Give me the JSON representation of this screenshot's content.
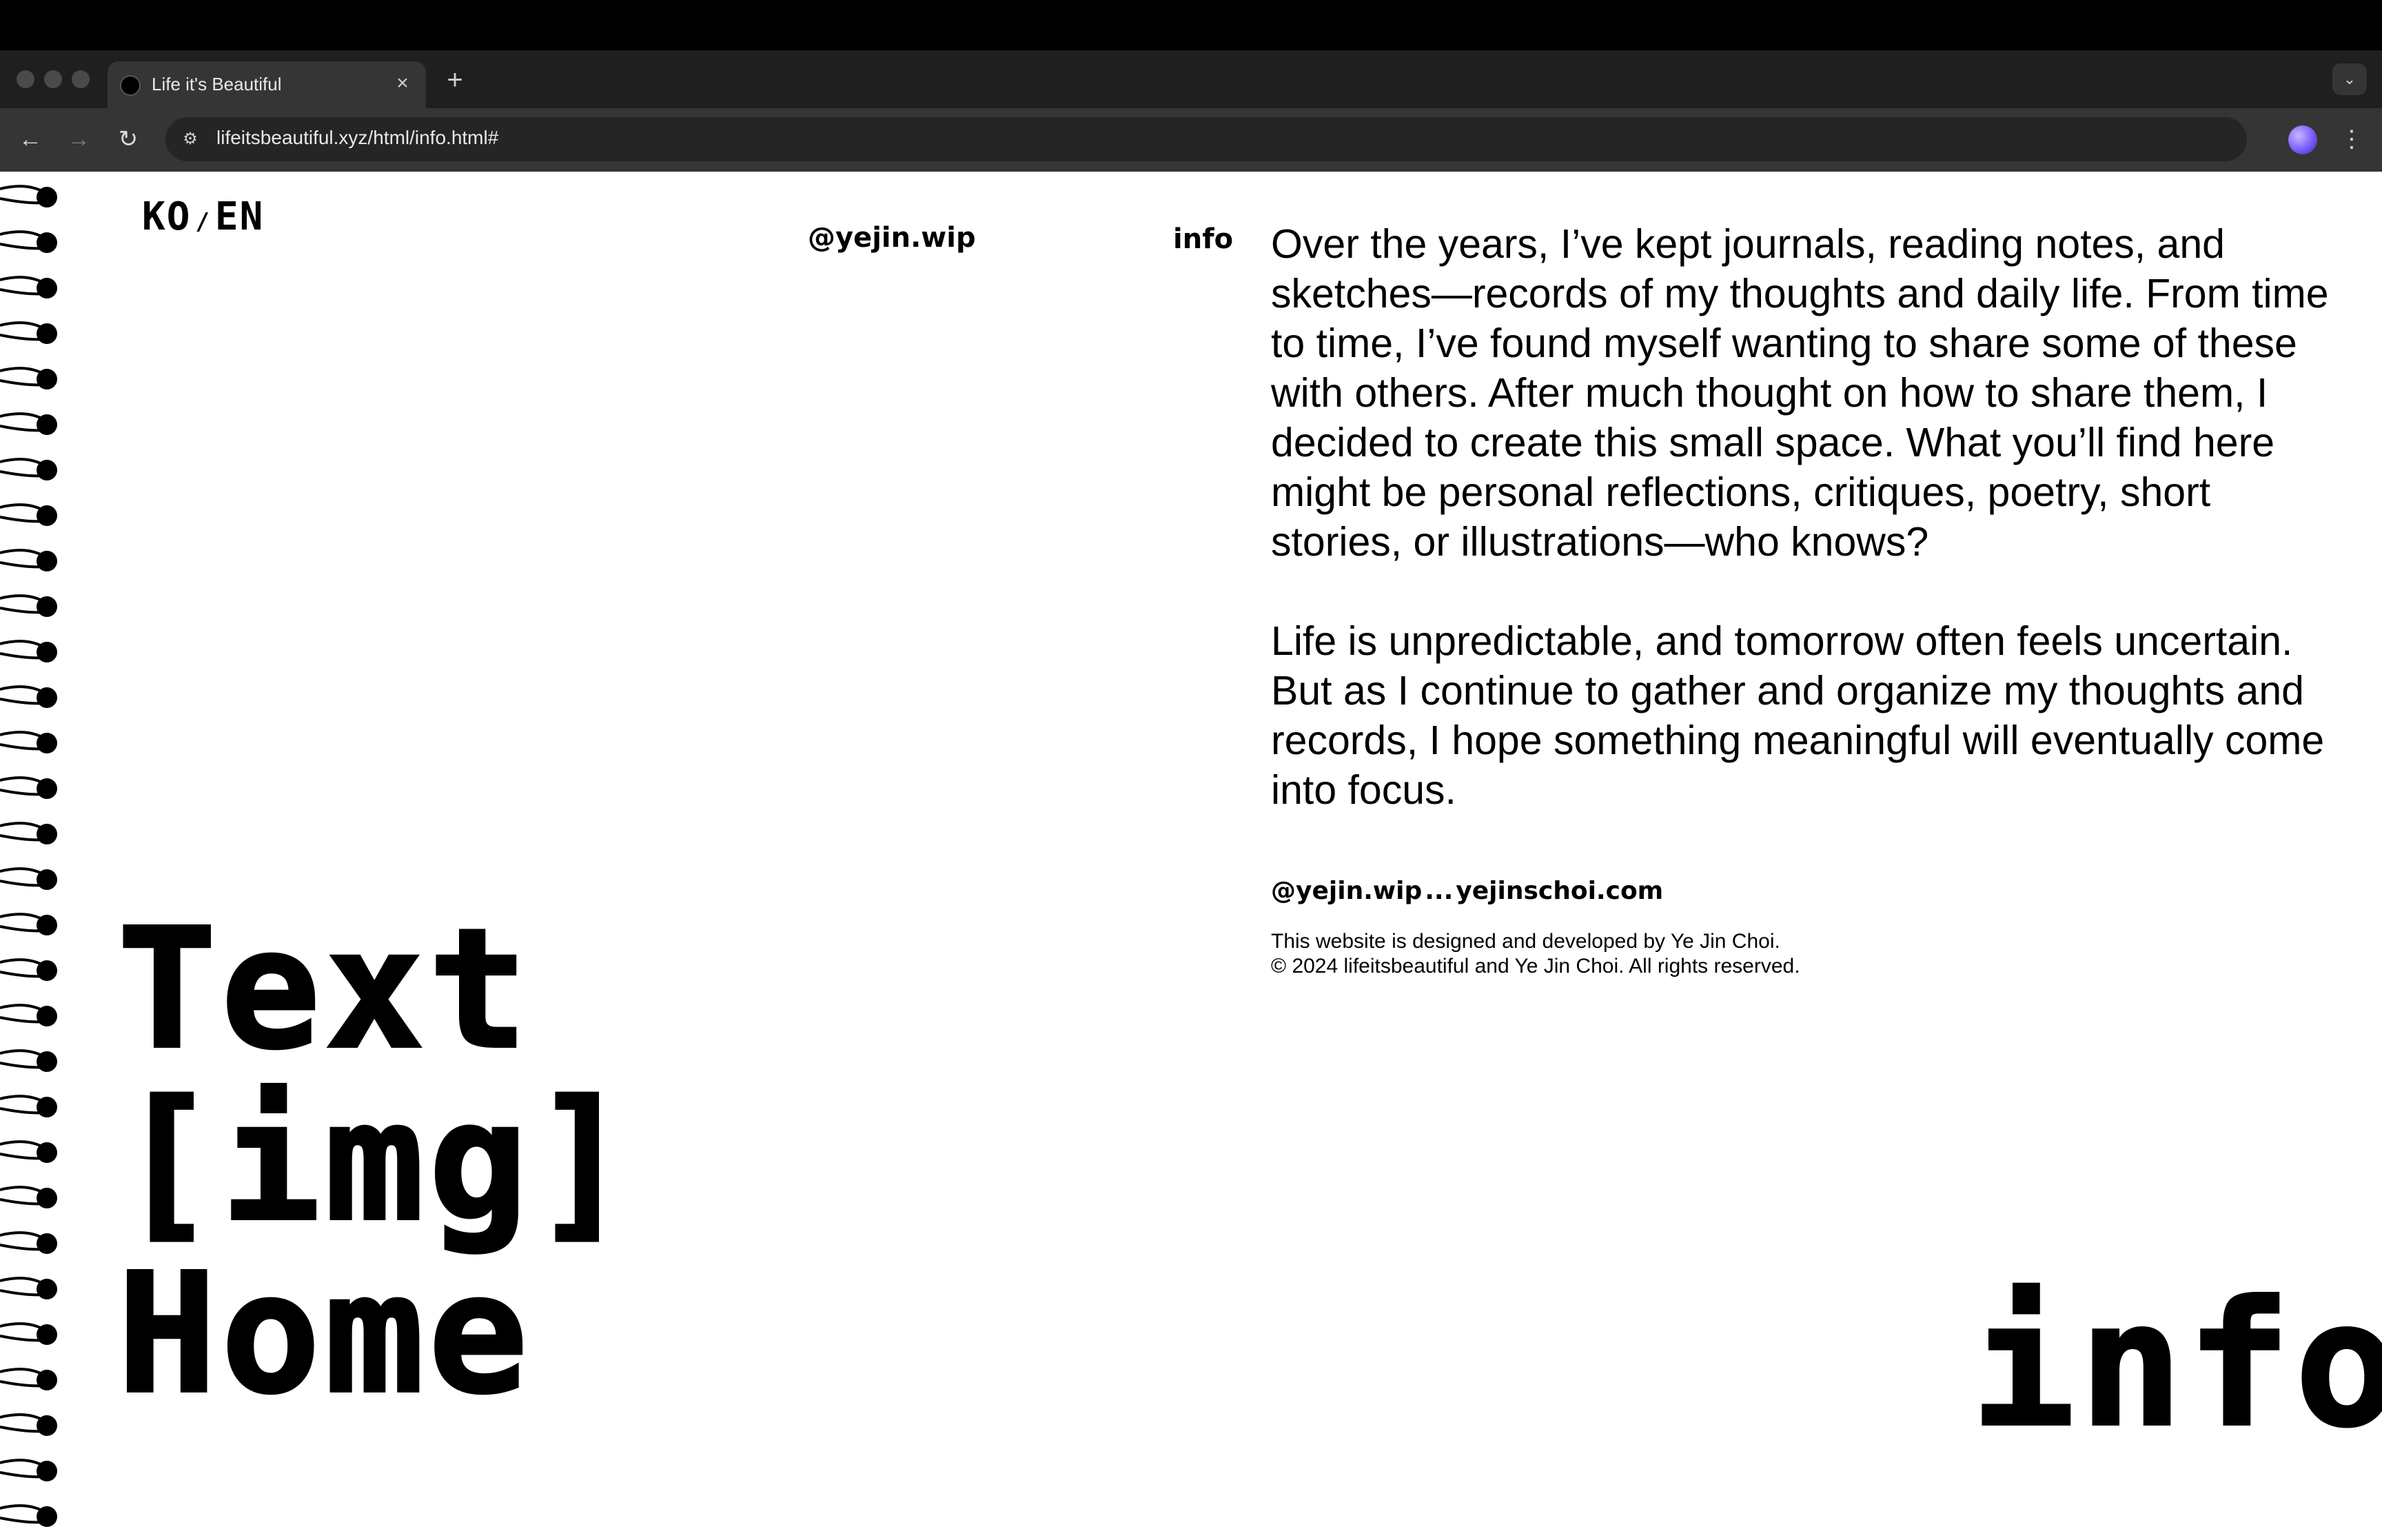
{
  "browser": {
    "tab_title": "Life it's Beautiful",
    "tab_close_glyph": "×",
    "new_tab_glyph": "+",
    "tab_menu_glyph": "⌄",
    "url": "lifeitsbeautiful.xyz/html/info.html#",
    "back_glyph": "←",
    "forward_glyph": "→",
    "reload_glyph": "↻",
    "site_info_glyph": "⚙",
    "star_glyph": "☆",
    "menu_glyph": "⋮"
  },
  "page": {
    "lang_ko": "KO",
    "lang_sep": "/",
    "lang_en": "EN",
    "handle": "@yejin.wip",
    "nav_info": "info",
    "paragraphs": [
      "Over the years, I’ve kept journals, reading notes, and sketches—records of my thoughts and daily life. From time to time, I’ve found myself wanting to share some of these with others. After much thought on how to share them, I decided to create this small space. What you’ll find here might be personal reflections, critiques, poetry, short stories, or illustrations—who knows?",
      "Life is unpredictable, and tomorrow often feels uncertain. But as I continue to gather and organize my thoughts and records, I hope something meaningful will eventually come into focus."
    ],
    "contacts": {
      "instagram": "@yejin.wip",
      "separator": "...",
      "website": "yejinschoi.com"
    },
    "credits": [
      "This website is designed and developed by Ye Jin Choi.",
      "© 2024 lifeitsbeautiful and Ye Jin Choi. All rights reserved."
    ],
    "menu": [
      "Text",
      "[img]",
      "Home"
    ],
    "current_section": "info"
  },
  "colors": {
    "background": "#ffffff",
    "text": "#000000",
    "chrome_dark": "#1f1f1f",
    "chrome_toolbar": "#353535"
  }
}
